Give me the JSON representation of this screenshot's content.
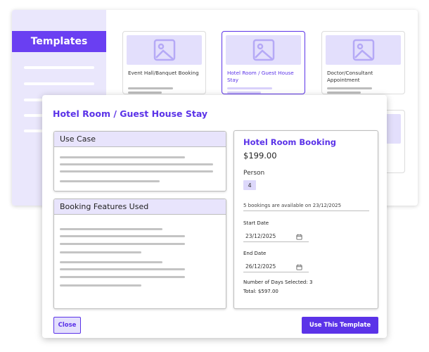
{
  "sidebar": {
    "templates_label": "Templates"
  },
  "cards": [
    {
      "title": "Event Hall/Banquet Booking",
      "image_icon": "image-icon"
    },
    {
      "title": "Hotel Room / Guest House Stay",
      "image_icon": "image-icon"
    },
    {
      "title": "Doctor/Consultant Appointment",
      "image_icon": "image-icon"
    }
  ],
  "modal": {
    "title": "Hotel Room / Guest House Stay",
    "use_case_header": "Use Case",
    "features_header": "Booking Features Used",
    "booking": {
      "title": "Hotel Room Booking",
      "price": "$199.00",
      "person_label": "Person",
      "person_count": "4",
      "availability": "5 bookings are available on 23/12/2025",
      "start_label": "Start Date",
      "start_value": "23/12/2025",
      "end_label": "End Date",
      "end_value": "26/12/2025",
      "days_selected": "Number of Days Selected: 3",
      "total": "Total: $597.00"
    },
    "close_label": "Close",
    "use_label": "Use This Template"
  },
  "colors": {
    "accent": "#5b33e8",
    "accent_light": "#e3dffc"
  }
}
